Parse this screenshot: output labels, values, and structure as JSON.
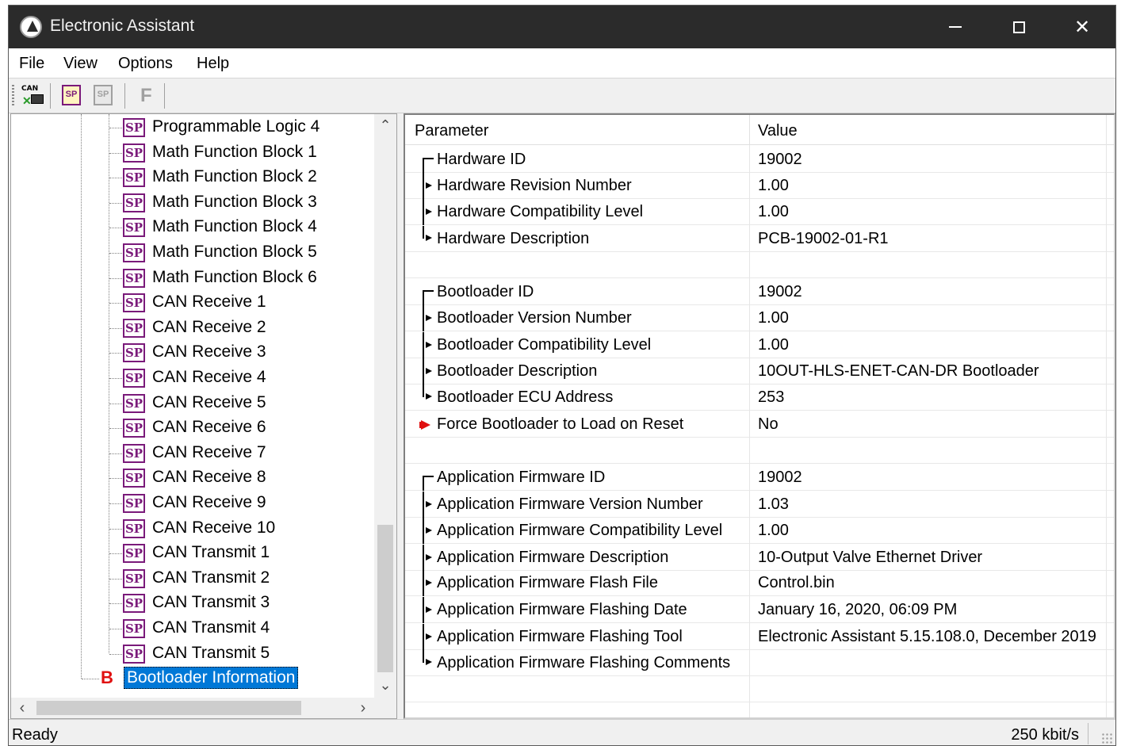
{
  "window": {
    "title": "Electronic Assistant"
  },
  "menu": [
    "File",
    "View",
    "Options",
    "Help"
  ],
  "toolbar": {
    "can_label": "CAN",
    "sp_label": "SP",
    "flash_label": "F"
  },
  "tree": {
    "items": [
      "Programmable Logic 4",
      "Math Function Block 1",
      "Math Function Block 2",
      "Math Function Block 3",
      "Math Function Block 4",
      "Math Function Block 5",
      "Math Function Block 6",
      "CAN Receive 1",
      "CAN Receive 2",
      "CAN Receive 3",
      "CAN Receive 4",
      "CAN Receive 5",
      "CAN Receive 6",
      "CAN Receive 7",
      "CAN Receive 8",
      "CAN Receive 9",
      "CAN Receive 10",
      "CAN Transmit 1",
      "CAN Transmit 2",
      "CAN Transmit 3",
      "CAN Transmit 4",
      "CAN Transmit 5"
    ],
    "icon_label": "SP",
    "selected": {
      "icon": "B",
      "label": "Bootloader Information"
    }
  },
  "grid": {
    "header": {
      "parameter": "Parameter",
      "value": "Value"
    },
    "rows": [
      {
        "param": "Hardware ID",
        "value": "19002",
        "marker": "top"
      },
      {
        "param": "Hardware Revision Number",
        "value": "1.00",
        "marker": "mid"
      },
      {
        "param": "Hardware Compatibility Level",
        "value": "1.00",
        "marker": "mid"
      },
      {
        "param": "Hardware Description",
        "value": "PCB-19002-01-R1",
        "marker": "bot"
      },
      {
        "param": "",
        "value": "",
        "marker": "none"
      },
      {
        "param": "Bootloader ID",
        "value": "19002",
        "marker": "top"
      },
      {
        "param": "Bootloader Version Number",
        "value": "1.00",
        "marker": "mid"
      },
      {
        "param": "Bootloader Compatibility Level",
        "value": "1.00",
        "marker": "mid"
      },
      {
        "param": "Bootloader Description",
        "value": "10OUT-HLS-ENET-CAN-DR Bootloader",
        "marker": "mid"
      },
      {
        "param": "Bootloader ECU Address",
        "value": "253",
        "marker": "bot"
      },
      {
        "param": "Force Bootloader to Load on Reset",
        "value": "No",
        "marker": "red"
      },
      {
        "param": "",
        "value": "",
        "marker": "none"
      },
      {
        "param": "Application Firmware ID",
        "value": "19002",
        "marker": "top"
      },
      {
        "param": "Application Firmware Version Number",
        "value": "1.03",
        "marker": "mid"
      },
      {
        "param": "Application Firmware Compatibility Level",
        "value": "1.00",
        "marker": "mid"
      },
      {
        "param": "Application Firmware Description",
        "value": "10-Output Valve Ethernet Driver",
        "marker": "mid"
      },
      {
        "param": "Application Firmware Flash File",
        "value": "Control.bin",
        "marker": "mid"
      },
      {
        "param": "Application Firmware Flashing Date",
        "value": "January 16, 2020, 06:09 PM",
        "marker": "mid"
      },
      {
        "param": "Application Firmware Flashing Tool",
        "value": "Electronic Assistant 5.15.108.0, December 2019",
        "marker": "mid"
      },
      {
        "param": "Application Firmware Flashing Comments",
        "value": "",
        "marker": "bot"
      },
      {
        "param": "",
        "value": "",
        "marker": "none"
      }
    ]
  },
  "status": {
    "left": "Ready",
    "right": "250 kbit/s"
  }
}
